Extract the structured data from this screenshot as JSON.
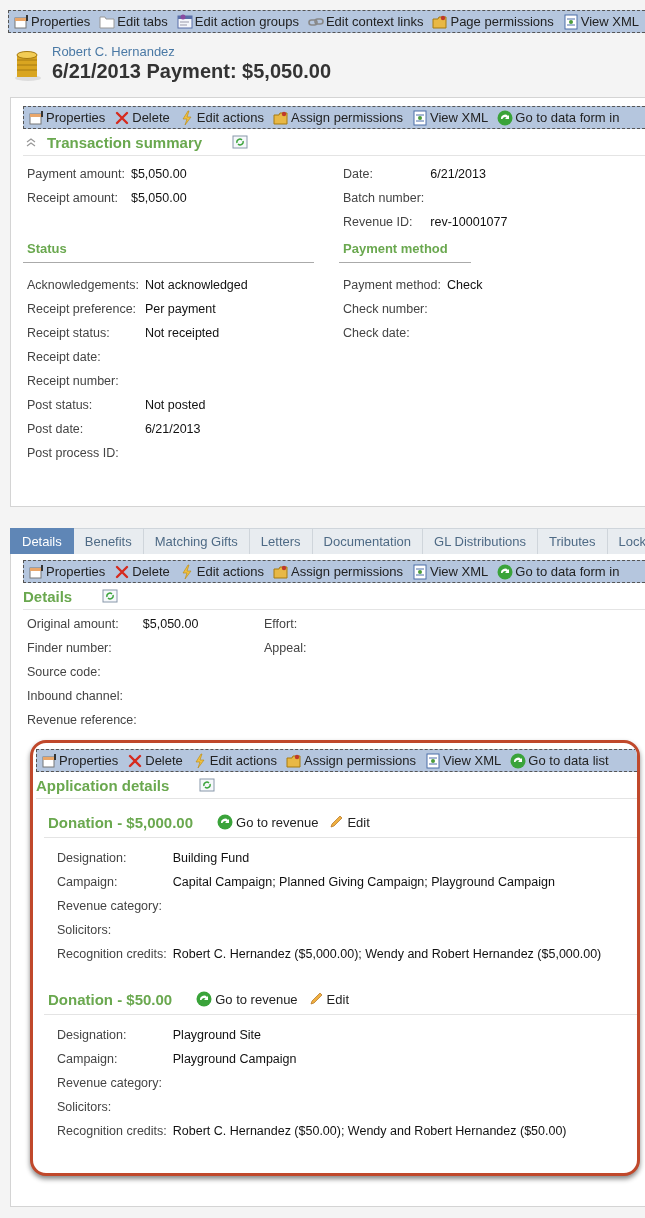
{
  "page_toolbar": [
    {
      "kind": "properties",
      "label": "Properties"
    },
    {
      "kind": "tabs",
      "label": "Edit tabs"
    },
    {
      "kind": "action-groups",
      "label": "Edit action groups"
    },
    {
      "kind": "links",
      "label": "Edit context links"
    },
    {
      "kind": "permissions",
      "label": "Page permissions"
    },
    {
      "kind": "xml",
      "label": "View XML"
    }
  ],
  "header": {
    "subtitle": "Robert C. Hernandez",
    "title": "6/21/2013 Payment: $5,050.00"
  },
  "summary_panel": {
    "toolbar": [
      {
        "kind": "properties",
        "label": "Properties"
      },
      {
        "kind": "delete",
        "label": "Delete"
      },
      {
        "kind": "edit-actions",
        "label": "Edit actions"
      },
      {
        "kind": "permissions",
        "label": "Assign permissions"
      },
      {
        "kind": "xml",
        "label": "View XML"
      },
      {
        "kind": "go",
        "label": "Go to data form in"
      }
    ],
    "title": "Transaction summary",
    "expanded": true,
    "fields_left": [
      {
        "label": "Payment amount:",
        "value": "$5,050.00"
      },
      {
        "label": "Receipt amount:",
        "value": "$5,050.00"
      }
    ],
    "fields_right": [
      {
        "label": "Date:",
        "value": "6/21/2013"
      },
      {
        "label": "Batch number:"
      },
      {
        "label": "Revenue ID:",
        "value": "rev-10001077"
      }
    ],
    "status": {
      "title": "Status",
      "fields": [
        {
          "label": "Acknowledgements:",
          "value": "Not acknowledged"
        },
        {
          "label": "Receipt preference:",
          "value": "Per payment"
        },
        {
          "label": "Receipt status:",
          "value": "Not receipted"
        },
        {
          "label": "Receipt date:"
        },
        {
          "label": "Receipt number:"
        },
        {
          "label": "Post status:",
          "value": "Not posted"
        },
        {
          "label": "Post date:",
          "value": "6/21/2013"
        },
        {
          "label": "Post process ID:"
        }
      ]
    },
    "payment_method": {
      "title": "Payment method",
      "fields": [
        {
          "label": "Payment method:",
          "value": "Check"
        },
        {
          "label": "Check number:"
        },
        {
          "label": "Check date:"
        }
      ]
    }
  },
  "tabs": [
    {
      "label": "Details",
      "selected": true
    },
    {
      "label": "Benefits",
      "selected": false
    },
    {
      "label": "Matching Gifts",
      "selected": false
    },
    {
      "label": "Letters",
      "selected": false
    },
    {
      "label": "Documentation",
      "selected": false
    },
    {
      "label": "GL Distributions",
      "selected": false
    },
    {
      "label": "Tributes",
      "selected": false
    },
    {
      "label": "Lock",
      "selected": false
    }
  ],
  "details_panel": {
    "toolbar": [
      {
        "kind": "properties",
        "label": "Properties"
      },
      {
        "kind": "delete",
        "label": "Delete"
      },
      {
        "kind": "edit-actions",
        "label": "Edit actions"
      },
      {
        "kind": "permissions",
        "label": "Assign permissions"
      },
      {
        "kind": "xml",
        "label": "View XML"
      },
      {
        "kind": "go",
        "label": "Go to data form in"
      }
    ],
    "title": "Details",
    "fields_left": [
      {
        "label": "Original amount:",
        "value": "$5,050.00"
      },
      {
        "label": "Finder number:"
      },
      {
        "label": "Source code:"
      },
      {
        "label": "Inbound channel:"
      },
      {
        "label": "Revenue reference:"
      }
    ],
    "fields_right": [
      {
        "label": "Effort:"
      },
      {
        "label": "Appeal:"
      }
    ]
  },
  "application_panel": {
    "highlighted": true,
    "toolbar": [
      {
        "kind": "properties",
        "label": "Properties"
      },
      {
        "kind": "delete",
        "label": "Delete"
      },
      {
        "kind": "edit-actions",
        "label": "Edit actions"
      },
      {
        "kind": "permissions",
        "label": "Assign permissions"
      },
      {
        "kind": "xml",
        "label": "View XML"
      },
      {
        "kind": "go",
        "label": "Go to data list"
      }
    ],
    "title": "Application details",
    "applications": [
      {
        "title": "Donation - $5,000.00",
        "actions": [
          {
            "kind": "go",
            "label": "Go to revenue"
          },
          {
            "kind": "edit",
            "label": "Edit"
          }
        ],
        "fields": [
          {
            "label": "Designation:",
            "value": "Building Fund"
          },
          {
            "label": "Campaign:",
            "value": "Capital Campaign; Planned Giving Campaign; Playground Campaign"
          },
          {
            "label": "Revenue category:"
          },
          {
            "label": "Solicitors:"
          },
          {
            "label": "Recognition credits:",
            "value": "Robert C. Hernandez ($5,000.00); Wendy and Robert Hernandez ($5,000.00)"
          }
        ]
      },
      {
        "title": "Donation - $50.00",
        "actions": [
          {
            "kind": "go",
            "label": "Go to revenue"
          },
          {
            "kind": "edit",
            "label": "Edit"
          }
        ],
        "fields": [
          {
            "label": "Designation:",
            "value": "Playground Site"
          },
          {
            "label": "Campaign:",
            "value": "Playground Campaign"
          },
          {
            "label": "Revenue category:"
          },
          {
            "label": "Solicitors:"
          },
          {
            "label": "Recognition credits:",
            "value": "Robert C. Hernandez ($50.00); Wendy and Robert Hernandez ($50.00)"
          }
        ]
      }
    ]
  }
}
